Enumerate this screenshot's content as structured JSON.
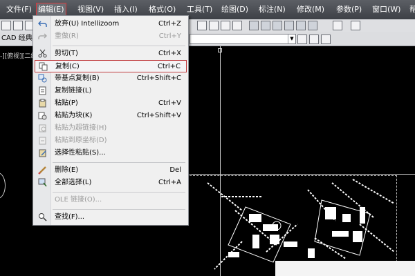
{
  "menubar": {
    "items": [
      "文件(F)",
      "编辑(E)",
      "视图(V)",
      "插入(I)",
      "格式(O)",
      "工具(T)",
      "绘图(D)",
      "标注(N)",
      "修改(M)",
      "参数(P)",
      "窗口(W)",
      "帮"
    ]
  },
  "toolbar": {
    "workspace_label": "CAD 经典",
    "layer_combo_value": ""
  },
  "viewport": {
    "title": "-][俯视][二维"
  },
  "edit_menu": {
    "items": [
      {
        "label": "放弃(U) Intellizoom",
        "shortcut": "Ctrl+Z",
        "icon": "undo-icon",
        "enabled": true
      },
      {
        "label": "重做(R)",
        "shortcut": "Ctrl+Y",
        "icon": "redo-icon",
        "enabled": false
      },
      {
        "label": "剪切(T)",
        "shortcut": "Ctrl+X",
        "icon": "scissors-icon",
        "enabled": true
      },
      {
        "label": "复制(C)",
        "shortcut": "Ctrl+C",
        "icon": "copy-icon",
        "enabled": true,
        "highlighted": true
      },
      {
        "label": "带基点复制(B)",
        "shortcut": "Ctrl+Shift+C",
        "icon": "copy-base-icon",
        "enabled": true
      },
      {
        "label": "复制链接(L)",
        "shortcut": "",
        "icon": "copy-link-icon",
        "enabled": true
      },
      {
        "label": "粘贴(P)",
        "shortcut": "Ctrl+V",
        "icon": "paste-icon",
        "enabled": true
      },
      {
        "label": "粘贴为块(K)",
        "shortcut": "Ctrl+Shift+V",
        "icon": "paste-block-icon",
        "enabled": true
      },
      {
        "label": "粘贴为超链接(H)",
        "shortcut": "",
        "icon": "paste-hyperlink-icon",
        "enabled": false
      },
      {
        "label": "粘贴到原坐标(D)",
        "shortcut": "",
        "icon": "paste-original-icon",
        "enabled": false
      },
      {
        "label": "选择性粘贴(S)...",
        "shortcut": "",
        "icon": "paste-special-icon",
        "enabled": true
      },
      {
        "label": "删除(E)",
        "shortcut": "Del",
        "icon": "eraser-icon",
        "enabled": true
      },
      {
        "label": "全部选择(L)",
        "shortcut": "Ctrl+A",
        "icon": "select-all-icon",
        "enabled": true
      },
      {
        "label": "OLE 链接(O)...",
        "shortcut": "",
        "icon": "",
        "enabled": false
      },
      {
        "label": "查找(F)...",
        "shortcut": "",
        "icon": "find-icon",
        "enabled": true
      }
    ]
  },
  "colors": {
    "highlight_border": "#c0393c",
    "menubar_bg": "#4a4d53",
    "canvas_bg": "#000000"
  }
}
